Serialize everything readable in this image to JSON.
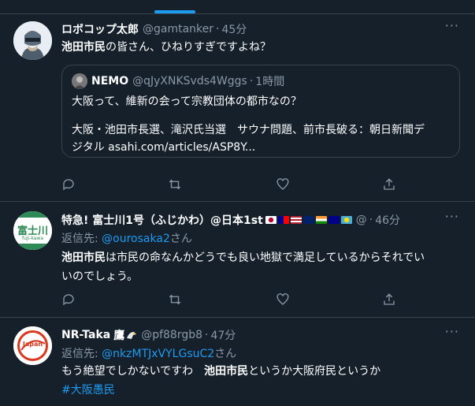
{
  "tweets": [
    {
      "name": "ロボコップ太郎",
      "handle": "@gamtanker",
      "dot": "·",
      "time": "45分",
      "more": "···",
      "text_hl": "池田市民",
      "text_rest": "の皆さん、ひねりすぎですよね？",
      "quote": {
        "name": "NEMO",
        "handle": "@qJyXNKSvds4Wggs",
        "dot": "·",
        "time": "1時間",
        "line1": "大阪って、維新の会って宗教団体の都市なの？",
        "line2": "大阪・池田市長選、滝沢氏当選　サウナ問題、前市長破る：朝日新聞デ",
        "line3": "ジタル asahi.com/articles/ASP8Y..."
      }
    },
    {
      "name": "特急! 富士川1号（ふじかわ）@日本1st",
      "flags_after": "@",
      "dot": "·",
      "time": "46分",
      "more": "···",
      "reply_prefix": "返信先: ",
      "reply_mention": "@ourosaka2",
      "reply_suffix": "さん",
      "text_hl": "池田市民",
      "text_rest1": "は市民の命なんかどうでも良い地獄で満足しているからそれでい",
      "text_rest2": "いのでしょう。",
      "avatar_text": "富士川",
      "avatar_subtext": "fuji-kawa"
    },
    {
      "name": "NR-Taka",
      "name_suffix": "鷹",
      "handle": "@pf88rgb8",
      "dot": "·",
      "time": "47分",
      "more": "···",
      "reply_prefix": "返信先: ",
      "reply_mention": "@nkzMTJxVYLGsuC2",
      "reply_suffix": "さん",
      "text_pre": "もう絶望でしかないですわ　",
      "text_hl": "池田市民",
      "text_post": "というか大阪府民というか",
      "hashtag": "#大阪愚民",
      "avatar_text": "Japan"
    }
  ],
  "colors": {
    "background": "#15202b",
    "border": "#38444d",
    "secondary_text": "#8b98a5",
    "accent": "#1d9bf0"
  },
  "icons": [
    "reply-icon",
    "retweet-icon",
    "like-icon",
    "share-icon",
    "more-icon"
  ]
}
